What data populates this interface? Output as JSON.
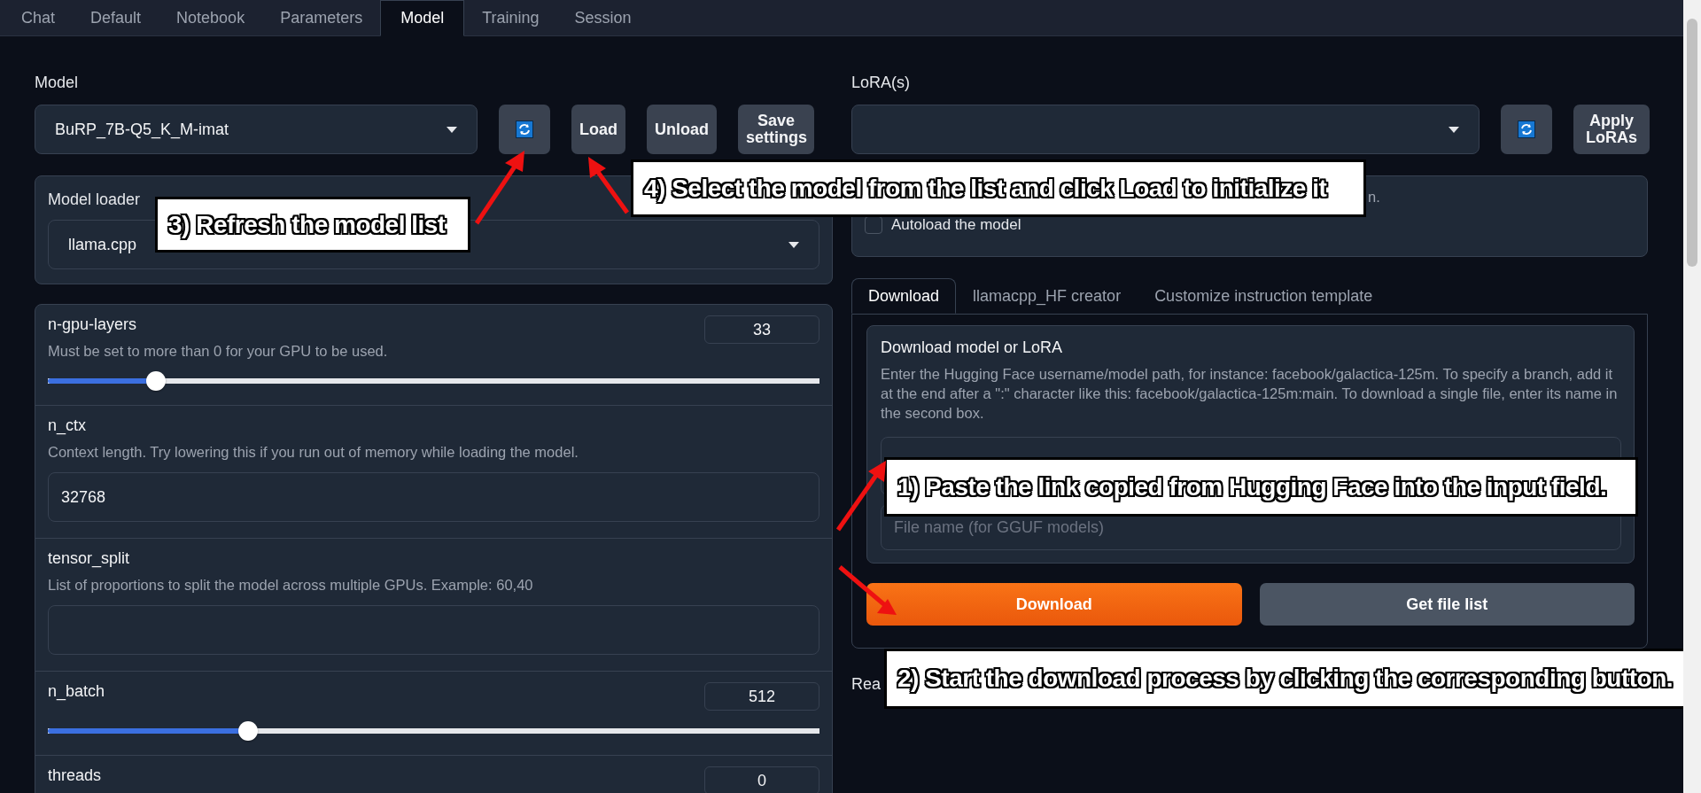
{
  "tabs": [
    {
      "label": "Chat",
      "selected": false
    },
    {
      "label": "Default",
      "selected": false
    },
    {
      "label": "Notebook",
      "selected": false
    },
    {
      "label": "Parameters",
      "selected": false
    },
    {
      "label": "Model",
      "selected": true
    },
    {
      "label": "Training",
      "selected": false
    },
    {
      "label": "Session",
      "selected": false
    }
  ],
  "model": {
    "label": "Model",
    "value": "BuRP_7B-Q5_K_M-imat",
    "buttons": [
      {
        "kind": "refresh"
      },
      {
        "kind": "text",
        "label": "Load"
      },
      {
        "kind": "text",
        "label": "Unload"
      },
      {
        "kind": "text",
        "label": "Save settings"
      }
    ]
  },
  "loader": {
    "label": "Model loader",
    "value": "llama.cpp"
  },
  "params": [
    {
      "kind": "slider",
      "name": "n-gpu-layers",
      "info": "Must be set to more than 0 for your GPU to be used.",
      "value": "33",
      "level": 0.14
    },
    {
      "kind": "text",
      "name": "n_ctx",
      "info": "Context length. Try lowering this if you run out of memory while loading the model.",
      "value": "32768"
    },
    {
      "kind": "text",
      "name": "tensor_split",
      "info": "List of proportions to split the model across multiple GPUs. Example: 60,40"
    },
    {
      "kind": "slider",
      "name": "n_batch",
      "value": "512",
      "level": 0.26
    },
    {
      "kind": "slider",
      "name": "threads",
      "value": "0"
    }
  ],
  "lora": {
    "label": "LoRA(s)",
    "buttons": [
      {
        "kind": "refresh"
      },
      {
        "kind": "text",
        "label": "Apply LoRAs"
      }
    ]
  },
  "autoload": {
    "note": "n.",
    "label": "Autoload the model",
    "checked": false
  },
  "download_tabs": [
    {
      "label": "Download",
      "selected": true
    },
    {
      "label": "llamacpp_HF creator",
      "selected": false
    },
    {
      "label": "Customize instruction template",
      "selected": false
    }
  ],
  "download": {
    "title": "Download model or LoRA",
    "info": "Enter the Hugging Face username/model path, for instance: facebook/galactica-125m. To specify a branch, add it at the end after a \":\" character like this: facebook/galactica-125m:main. To download a single file, enter its name in the second box.",
    "file_placeholder": "File name (for GGUF models)",
    "buttons": [
      {
        "kind": "primary",
        "label": "Download"
      },
      {
        "kind": "secondary",
        "label": "Get file list"
      }
    ]
  },
  "status_text": "Rea",
  "annotations": [
    {
      "text": "3) Refresh the model list"
    },
    {
      "text": "4) Select the model from the list and click Load to initialize it"
    },
    {
      "text": "1) Paste the link copied from Hugging Face into the input field."
    },
    {
      "text": "2) Start the download process by clicking the corresponding button."
    }
  ]
}
